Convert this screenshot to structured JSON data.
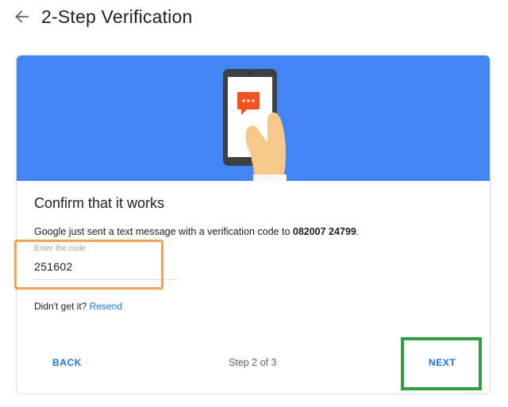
{
  "header": {
    "title": "2-Step Verification",
    "back_icon": "arrow-back-icon"
  },
  "card": {
    "illustration": {
      "icon": "phone-with-message-icon",
      "background_color": "#4285f4"
    },
    "heading": "Confirm that it works",
    "description_prefix": "Google just sent a text message with a verification code to ",
    "phone_number": "082007 24799",
    "description_suffix": ".",
    "code_input": {
      "label": "Enter the code",
      "value": "251602"
    },
    "resend": {
      "prompt": "Didn't get it?",
      "link": "Resend"
    },
    "footer": {
      "back_label": "BACK",
      "step_label": "Step 2 of 3",
      "next_label": "NEXT"
    }
  },
  "annotations": {
    "code_highlight_color": "#f0a15a",
    "next_highlight_color": "#2f9e3f"
  },
  "colors": {
    "accent": "#1a73e8",
    "hero": "#4285f4"
  }
}
